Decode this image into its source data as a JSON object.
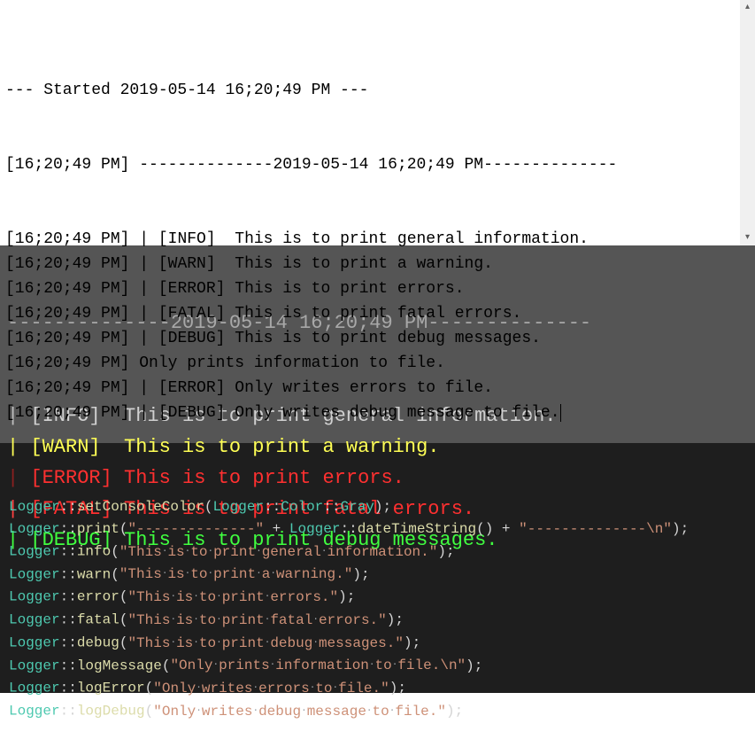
{
  "log": {
    "start_line": "--- Started 2019-05-14 16;20;49 PM ---",
    "header_ts": "[16;20;49 PM] ",
    "header_dashes_l": "--------------",
    "header_date": "2019-05-14 16;20;49 PM",
    "header_dashes_r": "--------------",
    "rows": [
      {
        "ts": "[16;20;49 PM]",
        "pipe": " | ",
        "tag": "[INFO] ",
        "msg": " This is to print general information."
      },
      {
        "ts": "[16;20;49 PM]",
        "pipe": " | ",
        "tag": "[WARN] ",
        "msg": " This is to print a warning."
      },
      {
        "ts": "[16;20;49 PM]",
        "pipe": " | ",
        "tag": "[ERROR]",
        "msg": " This is to print errors."
      },
      {
        "ts": "[16;20;49 PM]",
        "pipe": " | ",
        "tag": "[FATAL]",
        "msg": " This is to print fatal errors."
      },
      {
        "ts": "[16;20;49 PM]",
        "pipe": " | ",
        "tag": "[DEBUG]",
        "msg": " This is to print debug messages."
      },
      {
        "ts": "[16;20;49 PM]",
        "pipe": " ",
        "tag": "",
        "msg": "Only prints information to file."
      },
      {
        "ts": "[16;20;49 PM]",
        "pipe": " | ",
        "tag": "[ERROR]",
        "msg": " Only writes errors to file."
      },
      {
        "ts": "[16;20;49 PM]",
        "pipe": " | ",
        "tag": "[DEBUG]",
        "msg": " Only writes debug message to file."
      }
    ]
  },
  "console": {
    "header_dashes_l": "--------------",
    "header_date": "2019-05-14 16;20;49 PM",
    "header_dashes_r": "--------------",
    "rows": [
      {
        "pipecls": "pipe-gray",
        "tagcls": "info-tag",
        "txtcls": "info-txt",
        "tag": "[INFO] ",
        "msg": " This is to print general information."
      },
      {
        "pipecls": "pipe-yellow",
        "tagcls": "warn-tag",
        "txtcls": "warn-txt",
        "tag": "[WARN] ",
        "msg": " This is to print a warning."
      },
      {
        "pipecls": "pipe-darkred",
        "tagcls": "err-tag",
        "txtcls": "err-txt",
        "tag": "[ERROR]",
        "msg": " This is to print errors."
      },
      {
        "pipecls": "pipe-red",
        "tagcls": "fatal-tag",
        "txtcls": "fatal-txt",
        "tag": "[FATAL]",
        "msg": " This is to print fatal errors."
      },
      {
        "pipecls": "pipe-green",
        "tagcls": "dbg-tag",
        "txtcls": "dbg-txt",
        "tag": "[DEBUG]",
        "msg": " This is to print debug messages."
      }
    ]
  },
  "code": {
    "lines": [
      {
        "cls": "Logger",
        "fn": "setConsoleColor",
        "args": [
          {
            "t": "cls",
            "v": "Logger"
          },
          {
            "t": "op",
            "v": "::"
          },
          {
            "t": "cls",
            "v": "Color"
          },
          {
            "t": "op",
            "v": "::"
          },
          {
            "t": "cls",
            "v": "Gray"
          }
        ]
      },
      {
        "cls": "Logger",
        "fn": "print",
        "args": [
          {
            "t": "str",
            "v": "\"--------------\""
          },
          {
            "t": "op",
            "v": " + "
          },
          {
            "t": "cls",
            "v": "Logger"
          },
          {
            "t": "op",
            "v": "::"
          },
          {
            "t": "fn",
            "v": "dateTimeString"
          },
          {
            "t": "paren",
            "v": "()"
          },
          {
            "t": "op",
            "v": " + "
          },
          {
            "t": "str",
            "v": "\"--------------\\n\""
          }
        ]
      },
      {
        "cls": "Logger",
        "fn": "info",
        "args": [
          {
            "t": "str",
            "v": "\"This is to print general information.\""
          }
        ]
      },
      {
        "cls": "Logger",
        "fn": "warn",
        "args": [
          {
            "t": "str",
            "v": "\"This is to print a warning.\""
          }
        ]
      },
      {
        "cls": "Logger",
        "fn": "error",
        "args": [
          {
            "t": "str",
            "v": "\"This is to print errors.\""
          }
        ]
      },
      {
        "cls": "Logger",
        "fn": "fatal",
        "args": [
          {
            "t": "str",
            "v": "\"This is to print fatal errors.\""
          }
        ]
      },
      {
        "cls": "Logger",
        "fn": "debug",
        "args": [
          {
            "t": "str",
            "v": "\"This is to print debug messages.\""
          }
        ]
      },
      {
        "cls": "Logger",
        "fn": "logMessage",
        "args": [
          {
            "t": "str",
            "v": "\"Only prints information to file.\\n\""
          }
        ]
      },
      {
        "cls": "Logger",
        "fn": "logError",
        "args": [
          {
            "t": "str",
            "v": "\"Only writes errors to file.\""
          }
        ]
      },
      {
        "cls": "Logger",
        "fn": "logDebug",
        "args": [
          {
            "t": "str",
            "v": "\"Only writes debug message to file.\""
          }
        ]
      }
    ]
  }
}
